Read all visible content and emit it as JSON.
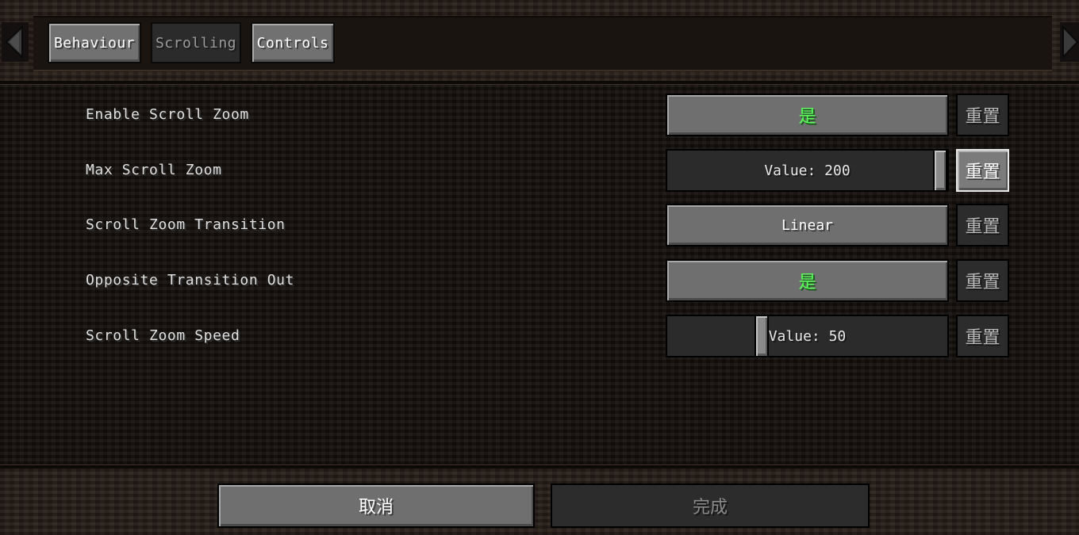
{
  "tabs": [
    {
      "label": "Behaviour",
      "state": "active"
    },
    {
      "label": "Scrolling",
      "state": "selected-disabled"
    },
    {
      "label": "Controls",
      "state": "active"
    }
  ],
  "settings": [
    {
      "label": "Enable Scroll Zoom",
      "control": "toggle",
      "value": "是",
      "value_color": "#55ff55",
      "reset_label": "重置"
    },
    {
      "label": "Max Scroll Zoom",
      "control": "slider",
      "value": "Value: 200",
      "slider_fraction": 1.0,
      "reset_label": "重置"
    },
    {
      "label": "Scroll Zoom Transition",
      "control": "cycle",
      "value": "Linear",
      "reset_label": "重置"
    },
    {
      "label": "Opposite Transition Out",
      "control": "toggle",
      "value": "是",
      "value_color": "#55ff55",
      "reset_label": "重置"
    },
    {
      "label": "Scroll Zoom Speed",
      "control": "slider",
      "value": "Value: 50",
      "slider_fraction": 0.33,
      "reset_label": "重置"
    }
  ],
  "footer": {
    "cancel_label": "取消",
    "done_label": "完成"
  },
  "colors": {
    "accent_green": "#55ff55",
    "button_gray": "#6f6f6f",
    "button_dark": "#2c2c2c"
  },
  "icons": {
    "left_arrow": "arrow-left-icon",
    "right_arrow": "arrow-right-icon"
  }
}
